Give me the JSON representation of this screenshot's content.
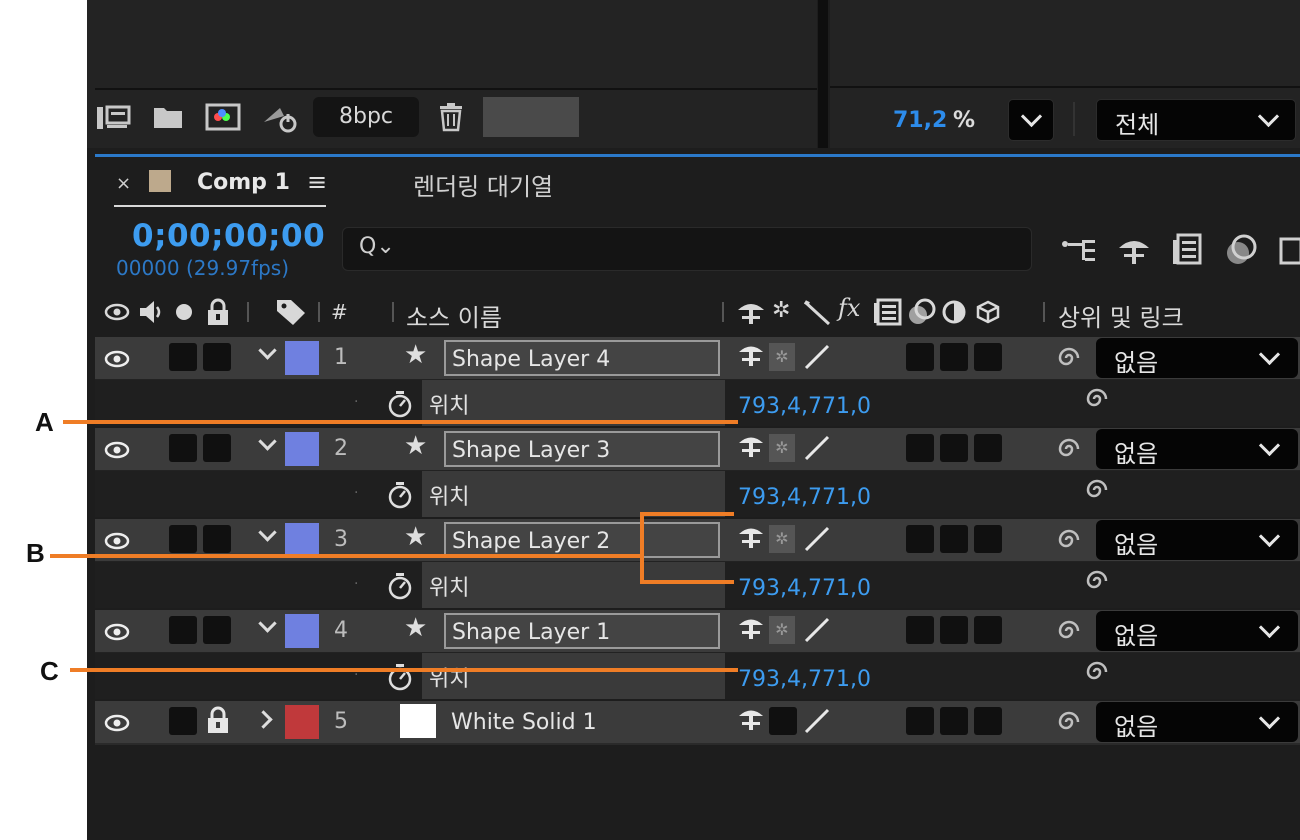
{
  "toolbar": {
    "bit_depth": "8bpc",
    "zoom_value": "71,2",
    "zoom_unit": "%",
    "view_option": "전체",
    "icons": [
      "flowchart-icon",
      "folder-icon",
      "composition-icon",
      "render-icon",
      "trash-icon"
    ]
  },
  "tabs": {
    "active_close": "×",
    "active_label": "Comp 1",
    "active_menu": "≡",
    "inactive_label": "렌더링 대기열",
    "active_color": "#bda98c"
  },
  "timeline": {
    "timecode": "0;00;00;00",
    "frames": "00000 (29.97fps)",
    "search_glyph": "Q⌄"
  },
  "columns": {
    "number": "#",
    "source_name": "소스 이름",
    "fx": "fx",
    "parent_link": "상위 및 링크"
  },
  "layers": [
    {
      "number": "1",
      "name": "Shape Layer 4",
      "label_color": "#6f80e0",
      "property": "위치",
      "value": "793,4,771,0",
      "parent": "없음"
    },
    {
      "number": "2",
      "name": "Shape Layer 3",
      "label_color": "#6f80e0",
      "property": "위치",
      "value": "793,4,771,0",
      "parent": "없음"
    },
    {
      "number": "3",
      "name": "Shape Layer 2",
      "label_color": "#6f80e0",
      "property": "위치",
      "value": "793,4,771,0",
      "parent": "없음"
    },
    {
      "number": "4",
      "name": "Shape Layer 1",
      "label_color": "#6f80e0",
      "property": "위치",
      "value": "793,4,771,0",
      "parent": "없음"
    },
    {
      "number": "5",
      "name": "White Solid 1",
      "label_color": "#c0393b",
      "parent": "없음"
    }
  ],
  "callouts": {
    "a": "A",
    "b": "B",
    "c": "C",
    "color": "#ef7d26"
  }
}
